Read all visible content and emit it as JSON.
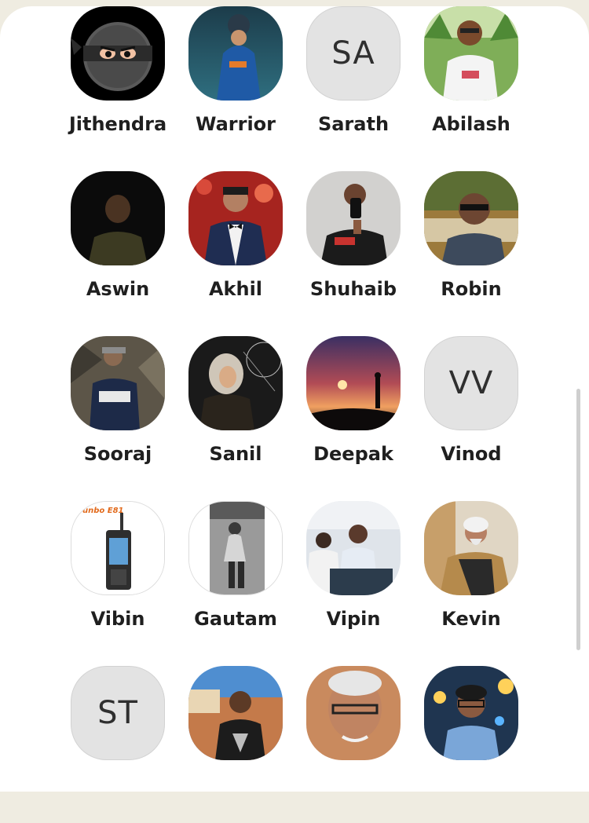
{
  "contacts": [
    {
      "name": "Jithendra",
      "avatar": "ninja-icon"
    },
    {
      "name": "Warrior",
      "avatar": "photo-cricketer"
    },
    {
      "name": "Sarath",
      "avatar": "initials",
      "initials": "SA"
    },
    {
      "name": "Abilash",
      "avatar": "photo-outdoor"
    },
    {
      "name": "Aswin",
      "avatar": "photo-dark"
    },
    {
      "name": "Akhil",
      "avatar": "photo-tuxedo"
    },
    {
      "name": "Shuhaib",
      "avatar": "photo-mirror-selfie"
    },
    {
      "name": "Robin",
      "avatar": "photo-glasses"
    },
    {
      "name": "Sooraj",
      "avatar": "photo-rocks"
    },
    {
      "name": "Sanil",
      "avatar": "photo-portrait-painting"
    },
    {
      "name": "Deepak",
      "avatar": "photo-sunset"
    },
    {
      "name": "Vinod",
      "avatar": "initials",
      "initials": "VV"
    },
    {
      "name": "Vibin",
      "avatar": "photo-radio-device",
      "brand_text": "unbo E81"
    },
    {
      "name": "Gautam",
      "avatar": "photo-bw-sitting"
    },
    {
      "name": "Vipin",
      "avatar": "photo-meeting"
    },
    {
      "name": "Kevin",
      "avatar": "photo-elder"
    },
    {
      "name": "",
      "avatar": "initials",
      "initials": "ST"
    },
    {
      "name": "",
      "avatar": "photo-outdoor-tshirt"
    },
    {
      "name": "",
      "avatar": "photo-man-glasses"
    },
    {
      "name": "",
      "avatar": "photo-man-lights"
    }
  ],
  "colors": {
    "background": "#efece1",
    "sheet": "#ffffff",
    "initials_bg": "#e3e3e3",
    "text": "#1f1f1f"
  }
}
